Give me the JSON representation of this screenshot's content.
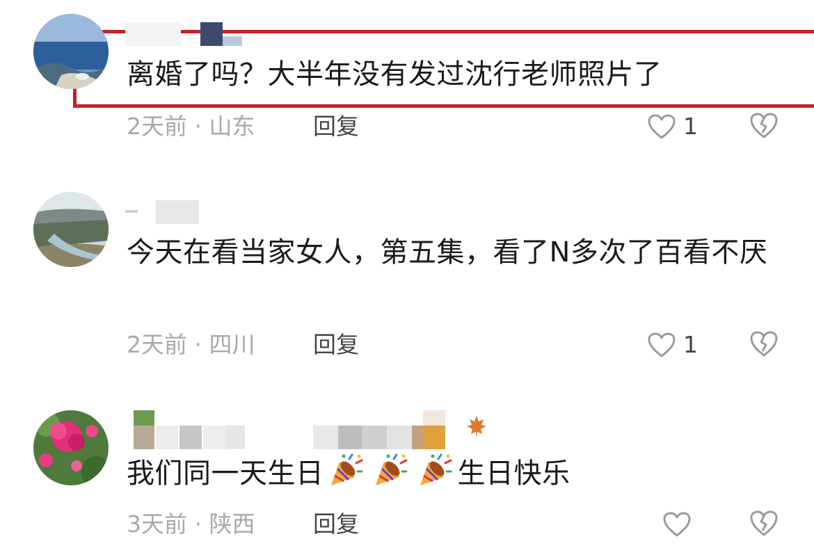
{
  "comments": [
    {
      "text": "离婚了吗？大半年没有发过沈行老师照片了",
      "time": "2天前",
      "location": "山东",
      "separator": "·",
      "reply_label": "回复",
      "likes": "1"
    },
    {
      "text": "今天在看当家女人，第五集，看了N多次了百看不厌",
      "time": "2天前",
      "location": "四川",
      "separator": "·",
      "reply_label": "回复",
      "likes": "1"
    },
    {
      "text_before": "我们同一天生日",
      "text_after": "生日快乐",
      "emoji_name": "party-popper-icon",
      "time": "3天前",
      "location": "陕西",
      "separator": "·",
      "reply_label": "回复",
      "likes": ""
    }
  ],
  "colors": {
    "highlight": "#c42026",
    "text": "#1a1a1a",
    "meta": "#a9a9a9"
  }
}
